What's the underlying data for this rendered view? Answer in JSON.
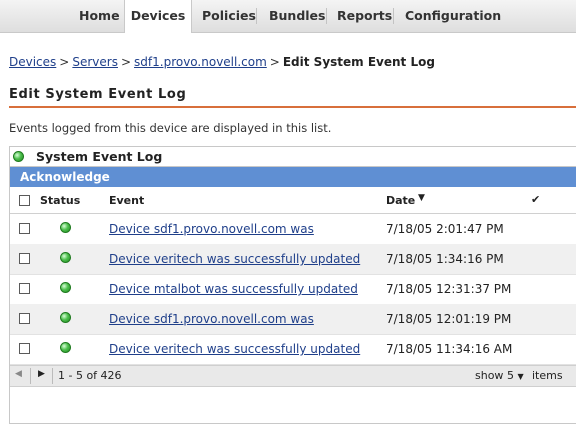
{
  "nav": {
    "tabs": [
      {
        "label": "Home"
      },
      {
        "label": "Devices"
      },
      {
        "label": "Policies"
      },
      {
        "label": "Bundles"
      },
      {
        "label": "Reports"
      },
      {
        "label": "Configuration"
      }
    ],
    "active_tab": "Devices"
  },
  "breadcrumb": {
    "items": [
      "Devices",
      "Servers",
      "sdf1.provo.novell.com"
    ],
    "separator": ">",
    "current": "Edit System Event Log"
  },
  "page": {
    "title": "Edit System Event Log",
    "description": "Events logged from this device are displayed in this list."
  },
  "panel": {
    "title": "System Event Log",
    "action": "Acknowledge",
    "columns": {
      "status": "Status",
      "event": "Event",
      "date": "Date"
    },
    "rows": [
      {
        "event": "Device sdf1.provo.novell.com was",
        "date": "7/18/05 2:01:47 PM"
      },
      {
        "event": "Device veritech was successfully updated",
        "date": "7/18/05 1:34:16 PM"
      },
      {
        "event": "Device mtalbot was successfully updated",
        "date": "7/18/05 12:31:37 PM"
      },
      {
        "event": "Device sdf1.provo.novell.com was",
        "date": "7/18/05 12:01:19 PM"
      },
      {
        "event": "Device veritech was successfully updated",
        "date": "7/18/05 11:34:16 AM"
      }
    ],
    "pager": {
      "range": "1 - 5 of 426",
      "show_label": "show",
      "page_size": "5",
      "items_label": "items"
    }
  },
  "colors": {
    "accent_rule": "#d86f3b",
    "action_bar": "#5f8fd3",
    "link": "#1f3f8a",
    "status_ok": "#4dbf4d"
  }
}
